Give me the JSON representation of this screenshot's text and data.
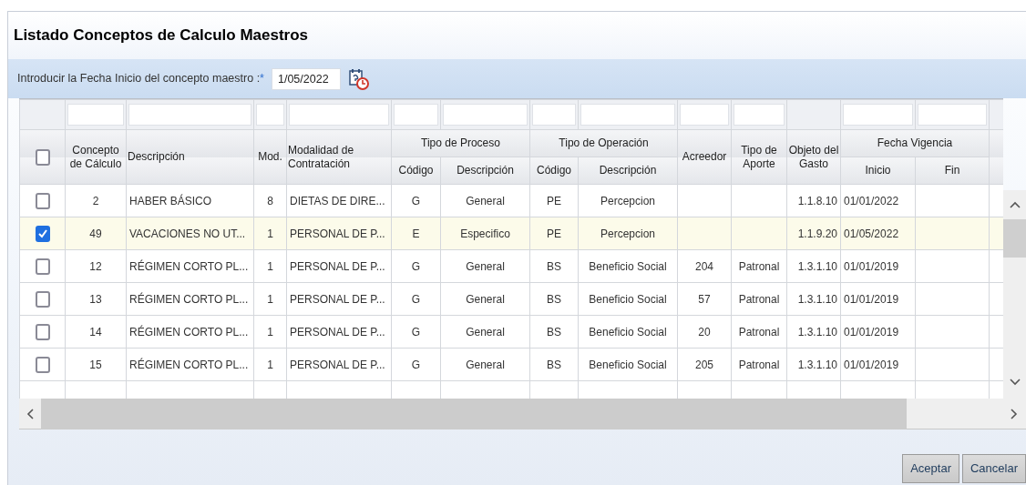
{
  "title": "Listado Conceptos de Calculo Maestros",
  "date_prompt": {
    "label": "Introducir la Fecha Inicio del concepto maestro :",
    "required_mark": "*",
    "value": "1/05/2022"
  },
  "table": {
    "select_all_checked": false,
    "columns": [
      {
        "label": "Concepto de Cálculo",
        "filter": true
      },
      {
        "label": "Descripción",
        "filter": true
      },
      {
        "label": "Mod.",
        "filter": true
      },
      {
        "label": "Modalidad de Contratación",
        "filter": true
      },
      {
        "label": "Tipo de Proceso",
        "colspan": 2,
        "children": [
          {
            "label": "Código",
            "filter": true
          },
          {
            "label": "Descripción",
            "filter": true
          }
        ]
      },
      {
        "label": "Tipo de Operación",
        "colspan": 2,
        "children": [
          {
            "label": "Código",
            "filter": true
          },
          {
            "label": "Descripción",
            "filter": true
          }
        ]
      },
      {
        "label": "Acreedor",
        "filter": true
      },
      {
        "label": "Tipo de Aporte",
        "filter": true
      },
      {
        "label": "Objeto del Gasto",
        "filter": false
      },
      {
        "label": "Fecha Vigencia",
        "colspan": 2,
        "children": [
          {
            "label": "Inicio",
            "filter": true
          },
          {
            "label": "Fin",
            "filter": true
          }
        ]
      }
    ],
    "rows": [
      {
        "checked": false,
        "cells": [
          "2",
          "HABER BÁSICO",
          "8",
          "DIETAS DE DIRE...",
          "G",
          "General",
          "PE",
          "Percepcion",
          null,
          null,
          "1.1.8.10",
          "01/01/2022",
          null
        ]
      },
      {
        "checked": true,
        "cells": [
          "49",
          "VACACIONES NO UT...",
          "1",
          "PERSONAL DE P...",
          "E",
          "Especifico",
          "PE",
          "Percepcion",
          null,
          null,
          "1.1.9.20",
          "01/05/2022",
          null
        ]
      },
      {
        "checked": false,
        "cells": [
          "12",
          "RÉGIMEN CORTO PL...",
          "1",
          "PERSONAL DE P...",
          "G",
          "General",
          "BS",
          "Beneficio Social",
          "204",
          "Patronal",
          "1.3.1.10",
          "01/01/2019",
          null
        ]
      },
      {
        "checked": false,
        "cells": [
          "13",
          "RÉGIMEN CORTO PL...",
          "1",
          "PERSONAL DE P...",
          "G",
          "General",
          "BS",
          "Beneficio Social",
          "57",
          "Patronal",
          "1.3.1.10",
          "01/01/2019",
          null
        ]
      },
      {
        "checked": false,
        "cells": [
          "14",
          "RÉGIMEN CORTO PL...",
          "1",
          "PERSONAL DE P...",
          "G",
          "General",
          "BS",
          "Beneficio Social",
          "20",
          "Patronal",
          "1.3.1.10",
          "01/01/2019",
          null
        ]
      },
      {
        "checked": false,
        "cells": [
          "15",
          "RÉGIMEN CORTO PL...",
          "1",
          "PERSONAL DE P...",
          "G",
          "General",
          "BS",
          "Beneficio Social",
          "205",
          "Patronal",
          "1.3.1.10",
          "01/01/2019",
          null
        ]
      }
    ]
  },
  "buttons": [
    {
      "label": "Aceptar"
    },
    {
      "label": "Cancelar"
    }
  ]
}
